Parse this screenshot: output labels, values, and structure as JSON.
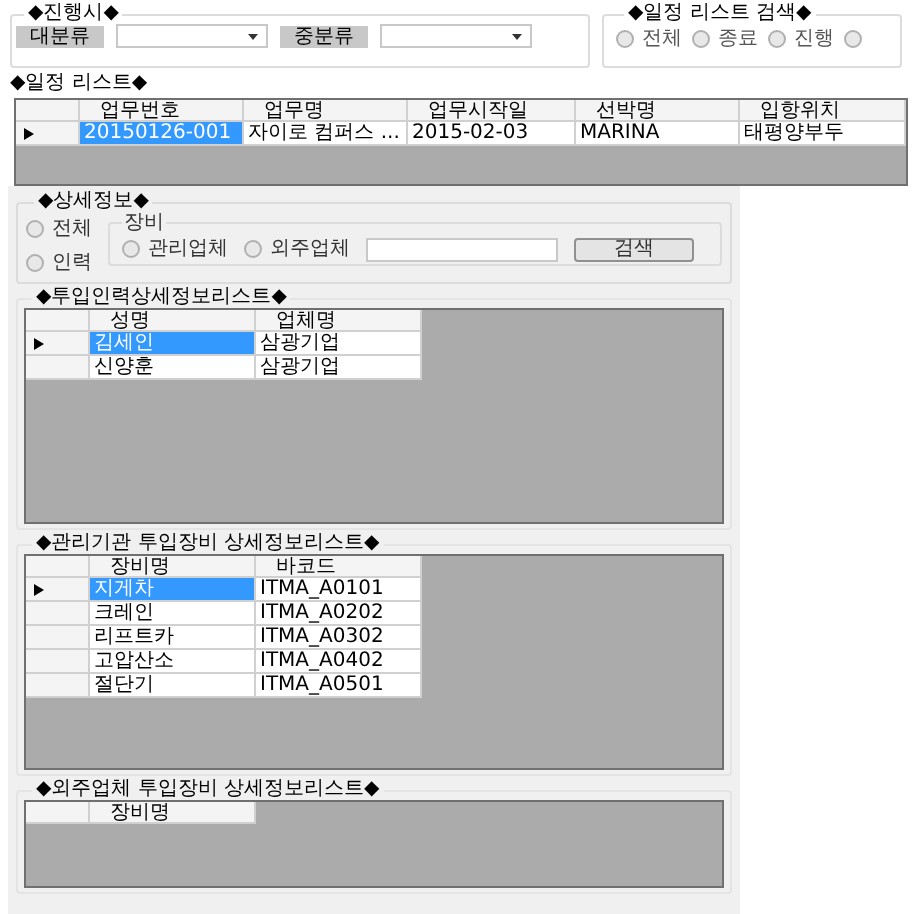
{
  "filter_group": {
    "title": "◆진행시◆",
    "filters": [
      {
        "label": "대분류"
      },
      {
        "label": "중분류"
      }
    ]
  },
  "search_group": {
    "title": "◆일정 리스트 검색◆",
    "radios": [
      {
        "label": "전체",
        "selected": false
      },
      {
        "label": "종료",
        "selected": false
      },
      {
        "label": "진행",
        "selected": false
      },
      {
        "selected": false
      }
    ]
  },
  "schedule_list": {
    "title": "◆일정 리스트◆",
    "columns": [
      "업무번호",
      "업무명",
      "업무시작일",
      "선박명",
      "입항위치"
    ],
    "rows": [
      {
        "selected": true,
        "cells": [
          "20150126-001",
          "자이로 컴퍼스 ...",
          "2015-02-03",
          "MARINA",
          "태평양부두"
        ]
      }
    ]
  },
  "detail": {
    "title": "◆상세정보◆",
    "radios": [
      {
        "label": "전체",
        "selected": false
      },
      {
        "label": "인력",
        "selected": false
      }
    ],
    "equipment_group": {
      "title": "장비",
      "radios": [
        {
          "label": "관리업체",
          "selected": false
        },
        {
          "label": "외주업체",
          "selected": false
        }
      ]
    },
    "search_button": "검색"
  },
  "grids": [
    {
      "title": "◆투입인력상세정보리스트◆",
      "columns": [
        "성명",
        "업체명"
      ],
      "rows": [
        {
          "selected": true,
          "cells": [
            "김세인",
            "삼광기업"
          ]
        },
        {
          "selected": false,
          "cells": [
            "신양훈",
            "삼광기업"
          ]
        }
      ]
    },
    {
      "title": "◆관리기관 투입장비 상세정보리스트◆",
      "columns": [
        "장비명",
        "바코드"
      ],
      "rows": [
        {
          "selected": true,
          "cells": [
            "지게차",
            "ITMA_A0101"
          ]
        },
        {
          "selected": false,
          "cells": [
            "크레인",
            "ITMA_A0202"
          ]
        },
        {
          "selected": false,
          "cells": [
            "리프트카",
            "ITMA_A0302"
          ]
        },
        {
          "selected": false,
          "cells": [
            "고압산소",
            "ITMA_A0402"
          ]
        },
        {
          "selected": false,
          "cells": [
            "절단기",
            "ITMA_A0501"
          ]
        }
      ]
    },
    {
      "title": "◆외주업체 투입장비 상세정보리스트◆",
      "columns": [
        "장비명"
      ]
    }
  ]
}
